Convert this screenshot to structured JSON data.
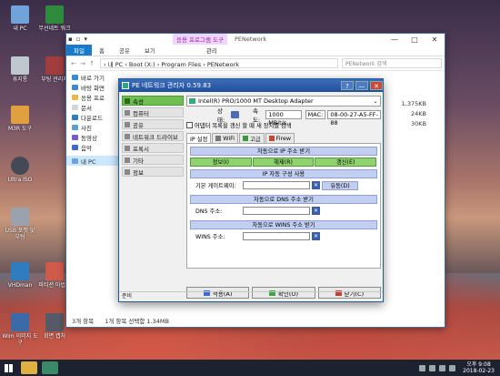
{
  "desktop": {
    "icons": [
      {
        "label": "내 PC",
        "color": "#6fa3d9"
      },
      {
        "label": "휴지통",
        "color": "#bfc7cf"
      },
      {
        "label": "M3R 도구",
        "color": "#e0a040"
      },
      {
        "label": "Ultra ISO",
        "color": "#444a55"
      },
      {
        "label": "USB 포맷 및 부팅",
        "color": "#9aa3ad"
      },
      {
        "label": "VHDman",
        "color": "#2f7cc0"
      },
      {
        "label": "Wim 이미지 도구",
        "color": "#3a6aa8"
      },
      {
        "label": "무선네트 워크",
        "color": "#2e8a3c"
      },
      {
        "label": "부팅 관리자",
        "color": "#a33c3c"
      },
      {
        "label": "파티션 마법사",
        "color": "#d05a4a"
      },
      {
        "label": "회면 캡처",
        "color": "#555a66"
      }
    ]
  },
  "explorer": {
    "quick_glyphs": [
      "▪",
      "▫",
      "▾"
    ],
    "tool_tab": "응용 프로그램 도구",
    "window_name": "PENetwork",
    "win_controls": [
      "—",
      "□",
      "✕"
    ],
    "ribbon_tabs": [
      "파일",
      "홈",
      "공유",
      "보기",
      "관리"
    ],
    "nav": [
      "←",
      "→",
      "↑"
    ],
    "address": "› 내 PC › Boot (X:) › Program Files › PENetwork",
    "search_placeholder": "PENetwork 검색",
    "sidebar": [
      "바로 가기",
      "바탕 화면",
      "응용 프로",
      "문서",
      "다운로드",
      "사진",
      "동영상",
      "음악",
      "내 PC"
    ],
    "sizes": [
      "1,375KB",
      "24KB",
      "30KB"
    ],
    "status": {
      "count": "3개 항목",
      "selected": "1개 항목 선택함 1.34MB"
    }
  },
  "pe": {
    "title": "PE 네트워크 관리자 0.59.83",
    "title_buttons": [
      "?",
      "—",
      "✕"
    ],
    "menu": [
      "속성",
      "컴퓨터",
      "공유",
      "네트워크 드라이브",
      "프록시",
      "기타",
      "정보"
    ],
    "adapter": "Intel(R) PRO/1000 MT Desktop Adapter",
    "status_label": "상태:",
    "speed_label": "속도:",
    "speed_value": "1000 MBit/s",
    "mac_label": "MAC:",
    "mac_value": "08-00-27-A5-FF-88",
    "checkbox_label": "어댑터 목록을 갱신 할 때 새 장치를 검색",
    "tabs": [
      "IP 설정",
      "WiFi",
      "고급",
      "Firew"
    ],
    "auto_ip_header": "자동으로 IP 주소 받기",
    "ip_buttons": [
      "정보(I)",
      "해제(R)",
      "갱신(E)"
    ],
    "manual_ip_header": "IP 자동 구성 사용",
    "gateway_label": "기본 게이트웨이:",
    "use_button": "유동(D)",
    "dns_header": "자동으로 DNS 주소 받기",
    "dns_label": "DNS 주소:",
    "wins_header": "자동으로 WINS 주소 받기",
    "wins_label": "WINS 주소:",
    "buttons": {
      "apply": "적용(A)",
      "ok": "확인(O)",
      "close": "닫기(C)"
    },
    "status": "준비"
  },
  "taskbar": {
    "time": "오후 9:08",
    "date": "2018-02-23"
  }
}
